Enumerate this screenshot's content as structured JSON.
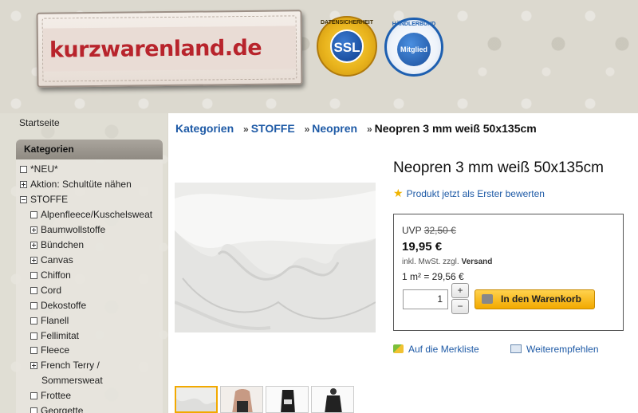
{
  "header": {
    "logo_text": "kurzwarenland.de",
    "badge_ssl": {
      "ring": "DATENSICHERHEIT",
      "center": "SSL"
    },
    "badge_haendlerbund": {
      "ring": "HÄNDLERBUND",
      "center": "Mitglied"
    }
  },
  "sidebar": {
    "home": "Startseite",
    "categories_title": "Kategorien",
    "items": [
      {
        "label": "*NEU*",
        "box": "empty"
      },
      {
        "label": "Aktion: Schultüte nähen",
        "box": "plus"
      },
      {
        "label": "STOFFE",
        "box": "minus"
      },
      {
        "label": "Alpenfleece/Kuschelsweat",
        "box": "empty"
      },
      {
        "label": "Baumwollstoffe",
        "box": "plus"
      },
      {
        "label": "Bündchen",
        "box": "plus"
      },
      {
        "label": "Canvas",
        "box": "plus"
      },
      {
        "label": "Chiffon",
        "box": "empty"
      },
      {
        "label": "Cord",
        "box": "empty"
      },
      {
        "label": "Dekostoffe",
        "box": "empty"
      },
      {
        "label": "Flanell",
        "box": "empty"
      },
      {
        "label": "Fellimitat",
        "box": "empty"
      },
      {
        "label": "Fleece",
        "box": "empty"
      },
      {
        "label": "French Terry /",
        "label2": "Sommersweat",
        "box": "plus"
      },
      {
        "label": "Frottee",
        "box": "empty"
      },
      {
        "label": "Georgette",
        "box": "empty"
      }
    ]
  },
  "breadcrumb": {
    "items": [
      "Kategorien",
      "STOFFE",
      "Neopren"
    ],
    "separator": "»",
    "current": "Neopren 3 mm weiß 50x135cm"
  },
  "product": {
    "title": "Neopren 3 mm weiß 50x135cm",
    "rate_link": "Produkt jetzt als Erster bewerten",
    "uvp_label": "UVP",
    "uvp_price": "32,50 €",
    "price": "19,95 €",
    "tax_text": "inkl. MwSt. zzgl.",
    "shipping_link": "Versand",
    "unit_price": "1 m² = 29,56 €",
    "quantity": "1",
    "plus": "+",
    "minus": "−",
    "cart_button": "In den Warenkorb",
    "wishlist": "Auf die Merkliste",
    "recommend": "Weiterempfehlen"
  },
  "colors": {
    "link": "#1e5aa6",
    "cart_button": "#f2a900",
    "logo_red": "#b8242c"
  }
}
